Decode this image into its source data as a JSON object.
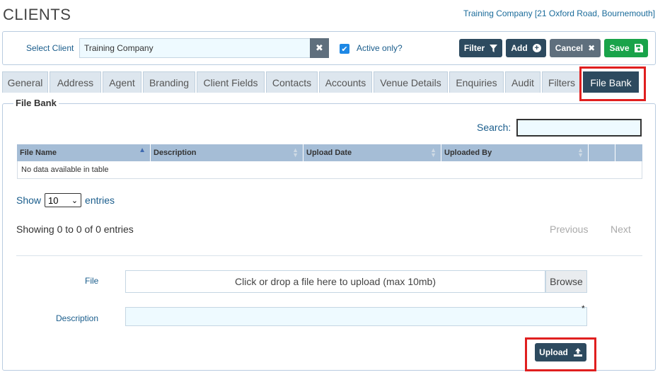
{
  "header": {
    "title": "CLIENTS",
    "company_link": "Training Company [21 Oxford Road, Bournemouth]"
  },
  "toolbar": {
    "select_client_label": "Select Client",
    "client_value": "Training Company",
    "active_only_label": "Active only?",
    "active_only_checked": true,
    "filter_label": "Filter",
    "add_label": "Add",
    "cancel_label": "Cancel",
    "save_label": "Save"
  },
  "tabs": [
    {
      "label": "General"
    },
    {
      "label": "Address"
    },
    {
      "label": "Agent"
    },
    {
      "label": "Branding"
    },
    {
      "label": "Client Fields"
    },
    {
      "label": "Contacts"
    },
    {
      "label": "Accounts"
    },
    {
      "label": "Venue Details"
    },
    {
      "label": "Enquiries"
    },
    {
      "label": "Audit"
    },
    {
      "label": "Filters"
    },
    {
      "label": "File Bank",
      "active": true
    }
  ],
  "file_bank": {
    "legend": "File Bank",
    "search_label": "Search:",
    "columns": [
      "File Name",
      "Description",
      "Upload Date",
      "Uploaded By",
      "",
      ""
    ],
    "empty_message": "No data available in table",
    "show_label": "Show",
    "page_size": "10",
    "entries_label": "entries",
    "info": "Showing 0 to 0 of 0 entries",
    "previous_label": "Previous",
    "next_label": "Next",
    "file_label": "File",
    "file_placeholder": "Click or drop a file here to upload (max 10mb)",
    "browse_label": "Browse",
    "description_label": "Description",
    "required_mark": "*",
    "upload_label": "Upload"
  },
  "colors": {
    "primary_dark": "#2d4a5f",
    "save_green": "#19a34a",
    "highlight_red": "#e01f1f",
    "input_bg": "#eefaff",
    "header_blue": "#a5bdd6"
  }
}
